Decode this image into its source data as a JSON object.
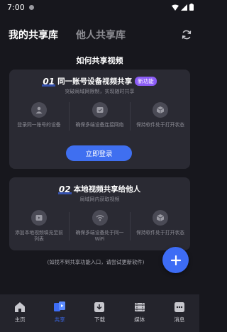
{
  "status_bar": {
    "time": "7:00"
  },
  "header": {
    "tab_mine": "我的共享库",
    "tab_others": "他人共享库"
  },
  "section_title": "如何共享视频",
  "card1": {
    "number": "01",
    "title": "同一账号设备视频共享",
    "badge": "新功能",
    "subtitle": "突破局域网限制，实现随时共享",
    "features": [
      {
        "icon": "user-icon",
        "text": "登录同一账号的设备"
      },
      {
        "icon": "wifi-check-icon",
        "text": "确保多端设备连接网络"
      },
      {
        "icon": "box-icon",
        "text": "保持软件处于打开状态"
      }
    ],
    "login_button": "立即登录"
  },
  "card2": {
    "number": "02",
    "title": "本地视频共享给他人",
    "subtitle": "局域网内获取视频",
    "features": [
      {
        "icon": "add-video-icon",
        "text": "添加本地视频填充至前列表"
      },
      {
        "icon": "wifi-icon",
        "text": "确保多端设备处于同一WiFi"
      },
      {
        "icon": "box-icon",
        "text": "保持软件处于打开状态"
      }
    ]
  },
  "hint": "(如找不到共享功能入口，请尝试更新软件)",
  "bottom_nav": [
    {
      "label": "主页",
      "icon": "home-icon",
      "active": false
    },
    {
      "label": "共享",
      "icon": "share-icon",
      "active": true
    },
    {
      "label": "下载",
      "icon": "download-icon",
      "active": false
    },
    {
      "label": "媒体",
      "icon": "media-icon",
      "active": false
    },
    {
      "label": "消息",
      "icon": "message-icon",
      "active": false
    }
  ],
  "colors": {
    "accent": "#3d6cf5",
    "badge": "#8b5cf6",
    "background": "#17171d",
    "card": "#2a2a33"
  }
}
